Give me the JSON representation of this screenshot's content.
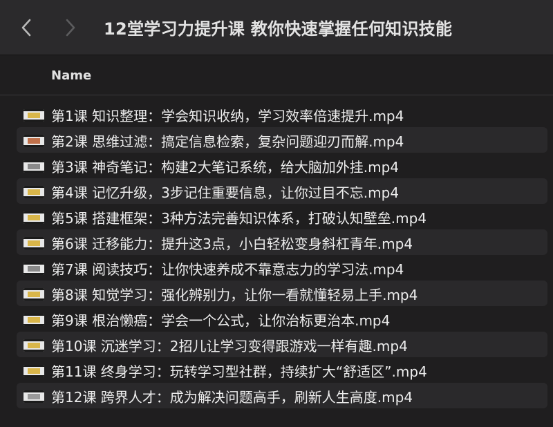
{
  "window": {
    "title": "12堂学习力提升课 教你快速掌握任何知识技能",
    "back_icon": "chevron-left-icon",
    "forward_icon": "chevron-right-icon"
  },
  "list_header": {
    "name_label": "Name"
  },
  "files": [
    {
      "name": "第1课 知识整理：学会知识收纳，学习效率倍速提升.mp4",
      "thumb_color": "#d9b64a"
    },
    {
      "name": "第2课 思维过滤：搞定信息检索，复杂问题迎刃而解.mp4",
      "thumb_color": "#c0704a"
    },
    {
      "name": "第3课 神奇笔记：构建2大笔记系统，给大脑加外挂.mp4",
      "thumb_color": "#8a8a8a"
    },
    {
      "name": "第4课 记忆升级，3步记住重要信息，让你过目不忘.mp4",
      "thumb_color": "#d9b64a"
    },
    {
      "name": "第5课 搭建框架：3种方法完善知识体系，打破认知壁垒.mp4",
      "thumb_color": "#d9b64a"
    },
    {
      "name": "第6课 迁移能力：提升这3点，小白轻松变身斜杠青年.mp4",
      "thumb_color": "#d9b64a"
    },
    {
      "name": "第7课 阅读技巧：让你快速养成不靠意志力的学习法.mp4",
      "thumb_color": "#8a8a8a"
    },
    {
      "name": "第8课 知觉学习：强化辨别力，让你一看就懂轻易上手.mp4",
      "thumb_color": "#d9b64a"
    },
    {
      "name": "第9课 根治懒癌：学会一个公式，让你治标更治本.mp4",
      "thumb_color": "#d9b64a"
    },
    {
      "name": "第10课 沉迷学习：2招儿让学习变得跟游戏一样有趣.mp4",
      "thumb_color": "#d9b64a"
    },
    {
      "name": "第11课 终身学习：玩转学习型社群，持续扩大“舒适区”.mp4",
      "thumb_color": "#d9b64a"
    },
    {
      "name": "第12课 跨界人才：成为解决问题高手，刷新人生高度.mp4",
      "thumb_color": "#9a9a9a"
    }
  ],
  "colors": {
    "background": "#1f1e1f",
    "titlebar": "#2b2a2c",
    "alt_row": "#2a292b",
    "text": "#ececec"
  }
}
